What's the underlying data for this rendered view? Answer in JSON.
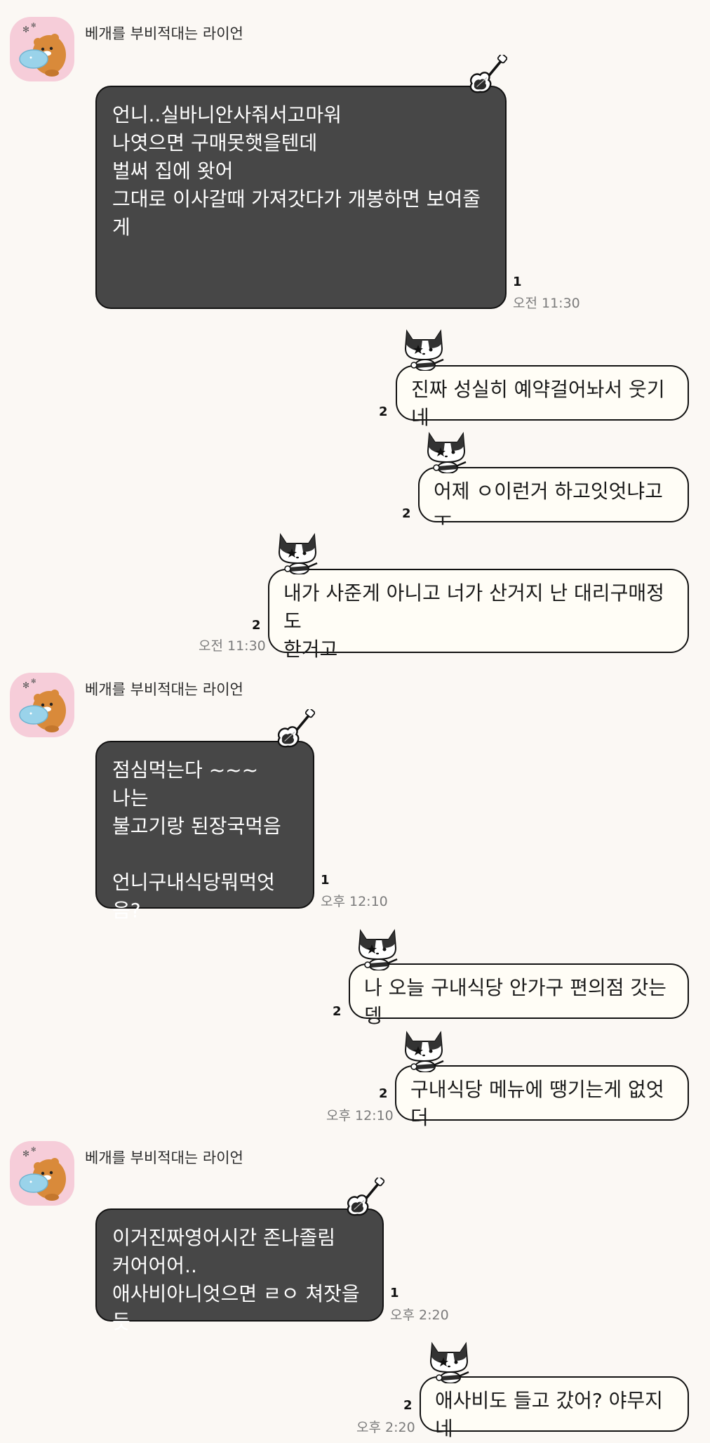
{
  "colors": {
    "background": "#fbf8f4",
    "incoming_bubble": "#474747",
    "outgoing_bubble": "#fffdf6",
    "avatar_bg": "#f6cdd9",
    "time_text": "#7b7b7b"
  },
  "sender_name": "베개를 부비적대는 라이언",
  "messages": [
    {
      "text": "언니..실바니안사줘서고마워\n나엿으면 구매못햇을텐데\n벌써 집에 왓어\n그대로 이사갈때 가져갓다가 개봉하면 보여줄게",
      "unread": "1",
      "time": "오전 11:30"
    },
    {
      "text": "진짜 성실히 예약걸어놔서 웃기네",
      "unread": "2"
    },
    {
      "text": "어제 ㅇ이런거 하고잇엇냐고ㅜ",
      "unread": "2"
    },
    {
      "text": "내가 사준게 아니고 너가 산거지 난 대리구매정도\n한거고",
      "unread": "2",
      "time": "오전 11:30"
    },
    {
      "text": "점심먹는다 ~~~\n나는\n불고기랑 된장국먹음\n\n언니구내식당뭐먹엇음?",
      "unread": "1",
      "time": "오후 12:10"
    },
    {
      "text": "나 오늘 구내식당 안가구 편의점 갓는뎅",
      "unread": "2"
    },
    {
      "text": "구내식당 메뉴에 땡기는게 없엇더",
      "unread": "2",
      "time": "오후 12:10"
    },
    {
      "text": "이거진짜영어시간 존나졸림\n커어어어..\n애사비아니엇으면 ㄹㅇ 쳐잣을듯",
      "unread": "1",
      "time": "오후 2:20"
    },
    {
      "text": "애사비도 들고 갔어? 야무지네",
      "unread": "2",
      "time": "오후 2:20"
    }
  ],
  "icons": {
    "avatar": "ryan-hugging-pillow-icon",
    "incoming_deco": "electric-guitar-icon",
    "outgoing_deco": "cat-with-guitar-icon"
  }
}
